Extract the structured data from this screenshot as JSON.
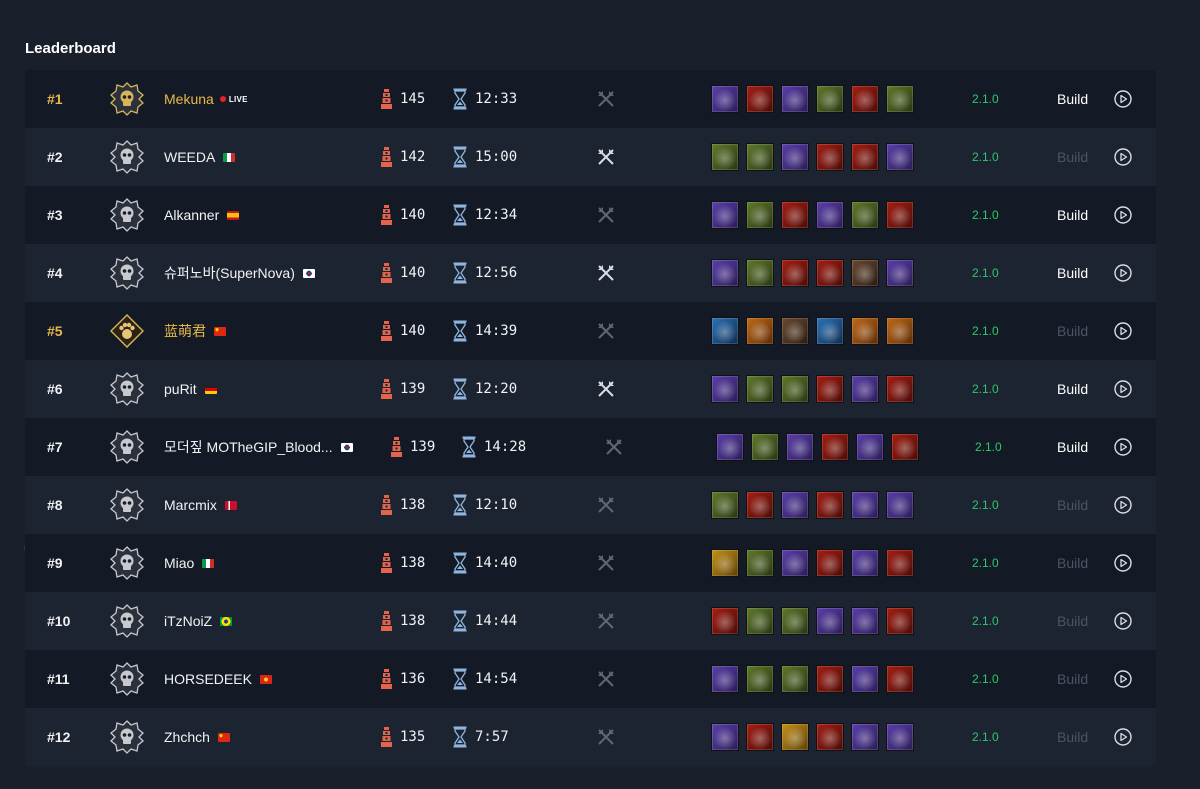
{
  "page": {
    "title": "Leaderboard"
  },
  "colors": {
    "gold": "#e8b94a",
    "version_green": "#2ec76a",
    "live_red": "#e0242b"
  },
  "rows": [
    {
      "rank": "#1",
      "highlight": true,
      "class_icon": "necromancer-skull-icon",
      "name": "Mekuna",
      "live": true,
      "live_label": "LIVE",
      "flag": "none",
      "tier": "145",
      "time": "12:33",
      "weapons_active": false,
      "skills": [
        "purple",
        "red",
        "purple",
        "green",
        "red",
        "green"
      ],
      "version": "2.1.0",
      "build_label": "Build",
      "build_active": true
    },
    {
      "rank": "#2",
      "highlight": false,
      "class_icon": "necromancer-skull-icon",
      "name": "WEEDA",
      "live": false,
      "flag": "italy-flag",
      "tier": "142",
      "time": "15:00",
      "weapons_active": true,
      "skills": [
        "green",
        "green",
        "purple",
        "red",
        "red",
        "purple"
      ],
      "version": "2.1.0",
      "build_label": "Build",
      "build_active": false
    },
    {
      "rank": "#3",
      "highlight": false,
      "class_icon": "necromancer-skull-icon",
      "name": "Alkanner",
      "live": false,
      "flag": "spain-flag",
      "tier": "140",
      "time": "12:34",
      "weapons_active": false,
      "skills": [
        "purple",
        "green",
        "red",
        "purple",
        "green",
        "red"
      ],
      "version": "2.1.0",
      "build_label": "Build",
      "build_active": true
    },
    {
      "rank": "#4",
      "highlight": false,
      "class_icon": "necromancer-skull-icon",
      "name": "슈퍼노바(SuperNova)",
      "live": false,
      "flag": "korea-flag",
      "tier": "140",
      "time": "12:56",
      "weapons_active": true,
      "skills": [
        "purple",
        "green",
        "red",
        "red",
        "brown",
        "purple"
      ],
      "version": "2.1.0",
      "build_label": "Build",
      "build_active": true
    },
    {
      "rank": "#5",
      "highlight": true,
      "class_icon": "druid-paw-icon",
      "name": "蓝萌君",
      "live": false,
      "flag": "china-flag",
      "tier": "140",
      "time": "14:39",
      "weapons_active": false,
      "skills": [
        "blue",
        "orange",
        "brown",
        "blue",
        "orange",
        "orange"
      ],
      "version": "2.1.0",
      "build_label": "Build",
      "build_active": false
    },
    {
      "rank": "#6",
      "highlight": false,
      "class_icon": "necromancer-skull-icon",
      "name": "puRit",
      "live": false,
      "flag": "germany-flag",
      "tier": "139",
      "time": "12:20",
      "weapons_active": true,
      "skills": [
        "purple",
        "green",
        "green",
        "red",
        "purple",
        "red"
      ],
      "version": "2.1.0",
      "build_label": "Build",
      "build_active": true
    },
    {
      "rank": "#7",
      "highlight": false,
      "class_icon": "necromancer-skull-icon",
      "name": "모더짚 MOTheGIP_Blood...",
      "live": false,
      "flag": "korea-flag",
      "tier": "139",
      "time": "14:28",
      "weapons_active": false,
      "skills": [
        "purple",
        "green",
        "purple",
        "red",
        "purple",
        "red"
      ],
      "version": "2.1.0",
      "build_label": "Build",
      "build_active": true
    },
    {
      "rank": "#8",
      "highlight": false,
      "class_icon": "necromancer-skull-icon",
      "name": "Marcmix",
      "live": false,
      "flag": "denmark-flag",
      "tier": "138",
      "time": "12:10",
      "weapons_active": false,
      "skills": [
        "green",
        "red",
        "purple",
        "red",
        "purple",
        "purple"
      ],
      "version": "2.1.0",
      "build_label": "Build",
      "build_active": false
    },
    {
      "rank": "#9",
      "highlight": false,
      "class_icon": "necromancer-skull-icon",
      "name": "Miao",
      "live": false,
      "flag": "italy-flag",
      "tier": "138",
      "time": "14:40",
      "weapons_active": false,
      "skills": [
        "gold",
        "green",
        "purple",
        "red",
        "purple",
        "red"
      ],
      "version": "2.1.0",
      "build_label": "Build",
      "build_active": false
    },
    {
      "rank": "#10",
      "highlight": false,
      "class_icon": "necromancer-skull-icon",
      "name": "iTzNoiZ",
      "live": false,
      "flag": "brazil-flag",
      "tier": "138",
      "time": "14:44",
      "weapons_active": false,
      "skills": [
        "red",
        "green",
        "green",
        "purple",
        "purple",
        "red"
      ],
      "version": "2.1.0",
      "build_label": "Build",
      "build_active": false
    },
    {
      "rank": "#11",
      "highlight": false,
      "class_icon": "necromancer-skull-icon",
      "name": "HORSEDEEK",
      "live": false,
      "flag": "vietnam-flag",
      "tier": "136",
      "time": "14:54",
      "weapons_active": false,
      "skills": [
        "purple",
        "green",
        "green",
        "red",
        "purple",
        "red"
      ],
      "version": "2.1.0",
      "build_label": "Build",
      "build_active": false
    },
    {
      "rank": "#12",
      "highlight": false,
      "class_icon": "necromancer-skull-icon",
      "name": "Zhchch",
      "live": false,
      "flag": "china-flag",
      "tier": "135",
      "time": "7:57",
      "weapons_active": false,
      "skills": [
        "purple",
        "red",
        "gold",
        "red",
        "purple",
        "purple"
      ],
      "version": "2.1.0",
      "build_label": "Build",
      "build_active": false
    }
  ]
}
